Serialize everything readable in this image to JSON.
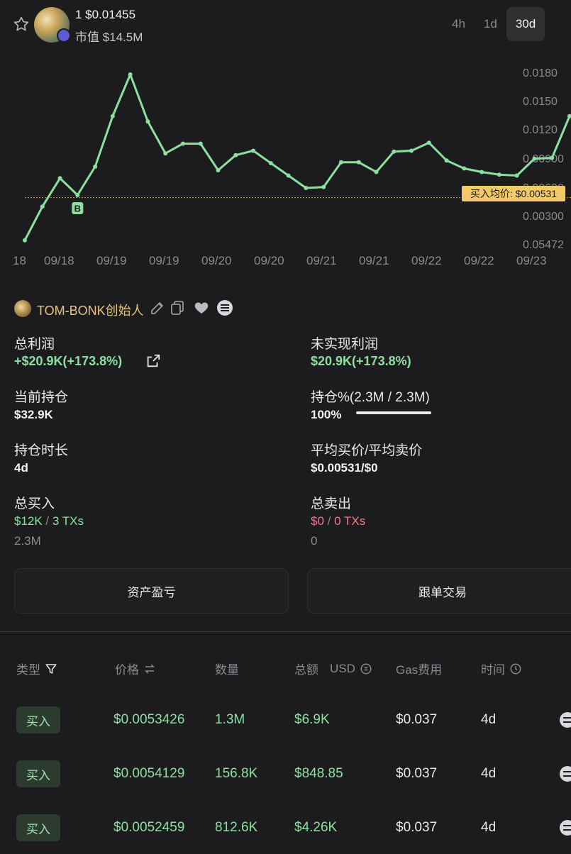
{
  "header": {
    "ticker": "1 $0.01455",
    "market_cap": "市值 $14.5M",
    "timeframes": [
      {
        "label": "4h",
        "active": false
      },
      {
        "label": "1d",
        "active": false
      },
      {
        "label": "30d",
        "active": true
      }
    ]
  },
  "chart_data": {
    "type": "line",
    "y_ticks": [
      "0.0180",
      "0.0150",
      "0.0120",
      "0.00900",
      "0.00600",
      "0.00300",
      "0.05472"
    ],
    "x_ticks": [
      "18",
      "09/18",
      "09/19",
      "09/19",
      "09/20",
      "09/20",
      "09/21",
      "09/21",
      "09/22",
      "09/22",
      "09/23"
    ],
    "ylim": [
      0,
      0.02
    ],
    "values": [
      0.0005,
      0.0043,
      0.0075,
      0.0056,
      0.0088,
      0.0145,
      0.0192,
      0.0139,
      0.0103,
      0.0114,
      0.0114,
      0.0084,
      0.0101,
      0.0106,
      0.0092,
      0.0078,
      0.0064,
      0.0065,
      0.0093,
      0.0093,
      0.0082,
      0.0105,
      0.0106,
      0.0115,
      0.0095,
      0.0086,
      0.0082,
      0.0079,
      0.0078,
      0.0097,
      0.0098,
      0.0145
    ],
    "reference_line": {
      "label": "买入均价: $0.00531",
      "value": 0.00531
    },
    "marker": {
      "label": "B",
      "index": 3
    },
    "color": "#8be0a0"
  },
  "wallet": {
    "name": "TOM-BONK创始人"
  },
  "stats": {
    "total_profit_label": "总利润",
    "total_profit_value": "+$20.9K(+173.8%)",
    "unrealized_label": "未实现利润",
    "unrealized_value": "$20.9K(+173.8%)",
    "position_label": "当前持仓",
    "position_value": "$32.9K",
    "holding_pct_label": "持仓%(2.3M / 2.3M)",
    "holding_pct_value": "100%",
    "holding_pct_fraction": 1.0,
    "duration_label": "持仓时长",
    "duration_value": "4d",
    "avg_price_label": "平均买价/平均卖价",
    "avg_price_value": "$0.00531/$0",
    "total_buy_label": "总买入",
    "total_buy_usd": "$12K",
    "total_buy_sep": " / ",
    "total_buy_txs": "3 TXs",
    "total_buy_amount": "2.3M",
    "total_sell_label": "总卖出",
    "total_sell_usd": "$0",
    "total_sell_sep": " / ",
    "total_sell_txs": "0 TXs",
    "total_sell_amount": "0"
  },
  "buttons": {
    "pnl": "资产盈亏",
    "copy_trade": "跟单交易"
  },
  "table": {
    "headers": {
      "type": "类型",
      "price": "价格",
      "qty": "数量",
      "total": "总额",
      "total_unit": "USD",
      "gas": "Gas费用",
      "time": "时间"
    },
    "rows": [
      {
        "type": "买入",
        "price": "$0.0053426",
        "qty": "1.3M",
        "total": "$6.9K",
        "gas": "$0.037",
        "time": "4d"
      },
      {
        "type": "买入",
        "price": "$0.0054129",
        "qty": "156.8K",
        "total": "$848.85",
        "gas": "$0.037",
        "time": "4d"
      },
      {
        "type": "买入",
        "price": "$0.0052459",
        "qty": "812.6K",
        "total": "$4.26K",
        "gas": "$0.037",
        "time": "4d"
      }
    ]
  }
}
